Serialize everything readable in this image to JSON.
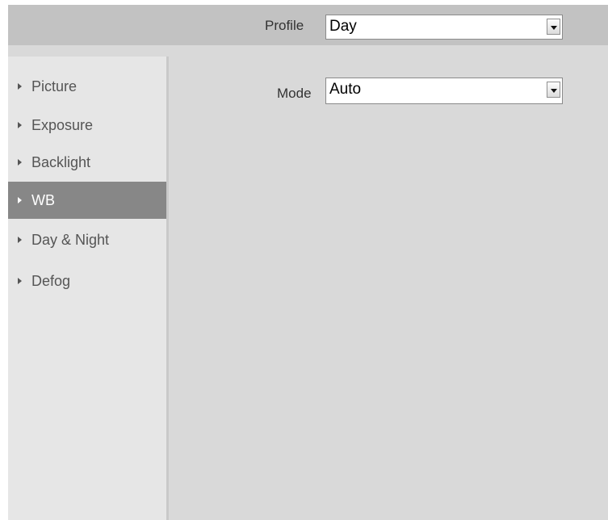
{
  "header": {
    "profile_label": "Profile",
    "profile_value": "Day"
  },
  "sidebar": {
    "items": [
      {
        "label": "Picture",
        "active": false
      },
      {
        "label": "Exposure",
        "active": false
      },
      {
        "label": "Backlight",
        "active": false
      },
      {
        "label": "WB",
        "active": true
      },
      {
        "label": "Day & Night",
        "active": false
      },
      {
        "label": "Defog",
        "active": false
      }
    ]
  },
  "main": {
    "mode_label": "Mode",
    "mode_value": "Auto"
  },
  "colors": {
    "background": "#d9d9d9",
    "header": "#c2c2c2",
    "sidebar": "#e6e6e6",
    "active_item": "#878787"
  }
}
